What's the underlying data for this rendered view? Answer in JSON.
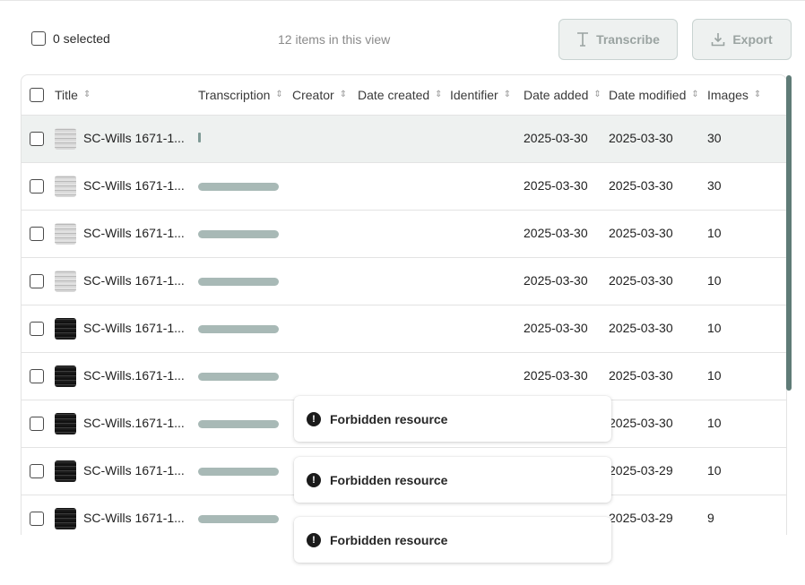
{
  "toolbar": {
    "selected_label": "0 selected",
    "count_label": "12 items in this view",
    "transcribe_label": "Transcribe",
    "export_label": "Export"
  },
  "table": {
    "columns": [
      "Title",
      "Transcription",
      "Creator",
      "Date created",
      "Identifier",
      "Date added",
      "Date modified",
      "Images"
    ],
    "rows": [
      {
        "title": "SC-Wills 1671-1...",
        "thumb": "light",
        "progress": "tiny",
        "date_added": "2025-03-30",
        "date_modified": "2025-03-30",
        "images": "30"
      },
      {
        "title": "SC-Wills 1671-1...",
        "thumb": "light",
        "progress": "full",
        "date_added": "2025-03-30",
        "date_modified": "2025-03-30",
        "images": "30"
      },
      {
        "title": "SC-Wills 1671-1...",
        "thumb": "light",
        "progress": "full",
        "date_added": "2025-03-30",
        "date_modified": "2025-03-30",
        "images": "10"
      },
      {
        "title": "SC-Wills 1671-1...",
        "thumb": "light",
        "progress": "full",
        "date_added": "2025-03-30",
        "date_modified": "2025-03-30",
        "images": "10"
      },
      {
        "title": "SC-Wills 1671-1...",
        "thumb": "dark",
        "progress": "full",
        "date_added": "2025-03-30",
        "date_modified": "2025-03-30",
        "images": "10"
      },
      {
        "title": "SC-Wills.1671-1...",
        "thumb": "dark",
        "progress": "full",
        "date_added": "2025-03-30",
        "date_modified": "2025-03-30",
        "images": "10"
      },
      {
        "title": "SC-Wills.1671-1...",
        "thumb": "dark",
        "progress": "full",
        "date_added": "",
        "date_modified": "2025-03-30",
        "images": "10"
      },
      {
        "title": "SC-Wills 1671-1...",
        "thumb": "dark",
        "progress": "full",
        "date_added": "",
        "date_modified": "2025-03-29",
        "images": "10"
      },
      {
        "title": "SC-Wills 1671-1...",
        "thumb": "dark",
        "progress": "full",
        "date_added": "",
        "date_modified": "2025-03-29",
        "images": "9"
      }
    ]
  },
  "toasts": [
    {
      "message": "Forbidden resource"
    },
    {
      "message": "Forbidden resource"
    },
    {
      "message": "Forbidden resource"
    }
  ],
  "colors": {
    "accent": "#5f7b77",
    "progress": "#a8b9b6",
    "highlight_row": "#eef1f0"
  },
  "icons": {
    "transcribe": "text-cursor-icon",
    "export": "download-icon",
    "toast": "alert-circle-icon",
    "sort": "sort-chevrons-icon"
  }
}
